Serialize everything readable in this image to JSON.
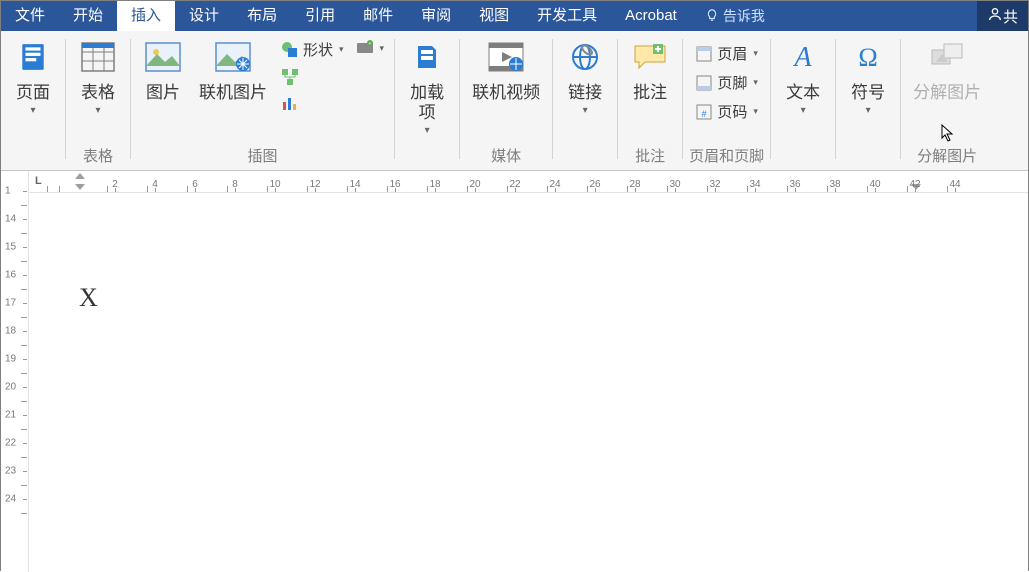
{
  "tabs": {
    "file": "文件",
    "home": "开始",
    "insert": "插入",
    "design": "设计",
    "layout": "布局",
    "ref": "引用",
    "mail": "邮件",
    "review": "审阅",
    "view": "视图",
    "dev": "开发工具",
    "acrobat": "Acrobat",
    "tell_me": "告诉我",
    "share": "共"
  },
  "groups": {
    "page_group": "",
    "table_group": "表格",
    "illus_group": "插图",
    "media_group": "媒体",
    "links_group": "",
    "comment_group": "批注",
    "hf_group": "页眉和页脚",
    "text_group": "",
    "symbol_group": "",
    "decompose_group": "分解图片"
  },
  "btn": {
    "page": "页面",
    "table": "表格",
    "picture": "图片",
    "online_pic": "联机图片",
    "shapes": "形状",
    "addin": "加载\n项",
    "online_video": "联机视频",
    "link": "链接",
    "comment": "批注",
    "header": "页眉",
    "footer": "页脚",
    "page_num": "页码",
    "text": "文本",
    "symbol": "符号",
    "decompose": "分解图片"
  },
  "doc": {
    "content": "X"
  },
  "ruler": {
    "h_marks": [
      2,
      4,
      6,
      8,
      10,
      12,
      14,
      16,
      18,
      20,
      22,
      24,
      26,
      28,
      30,
      32,
      34,
      36,
      38,
      40,
      42,
      44
    ],
    "v_marks": [
      1,
      14,
      15,
      16,
      17,
      18,
      19,
      20,
      21,
      22,
      23,
      24
    ]
  }
}
